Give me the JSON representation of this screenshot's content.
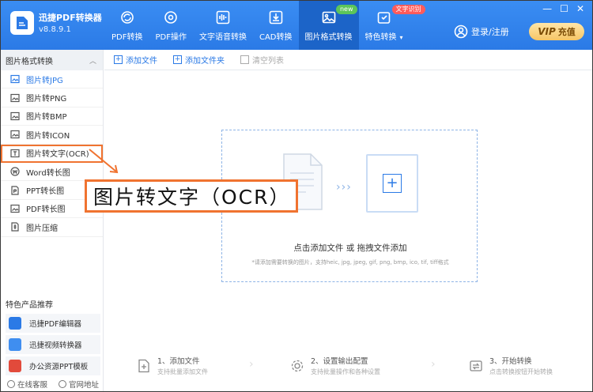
{
  "app": {
    "name": "迅捷PDF转换器",
    "version": "v8.8.9.1"
  },
  "nav": [
    {
      "label": "PDF转换",
      "icon": "refresh-icon"
    },
    {
      "label": "PDF操作",
      "icon": "compass-icon"
    },
    {
      "label": "文字语音转换",
      "icon": "audio-wave-icon"
    },
    {
      "label": "CAD转换",
      "icon": "download-box-icon"
    },
    {
      "label": "图片格式转换",
      "icon": "image-icon",
      "badge": "new",
      "active": true
    },
    {
      "label": "特色转换",
      "icon": "star-refresh-icon",
      "badge": "文字识别",
      "caret": "▾"
    }
  ],
  "header": {
    "login": "登录/注册",
    "vip_mark": "VIP",
    "vip_label": "充值",
    "win": {
      "min": "—",
      "max": "☐",
      "close": "✕"
    }
  },
  "sidebar": {
    "title": "图片格式转换",
    "collapse": "︿",
    "items": [
      {
        "label": "图片转JPG",
        "active": true
      },
      {
        "label": "图片转PNG"
      },
      {
        "label": "图片转BMP"
      },
      {
        "label": "图片转ICON"
      },
      {
        "label": "图片转文字(OCR)",
        "highlight": true
      },
      {
        "label": "Word转长图"
      },
      {
        "label": "PPT转长图"
      },
      {
        "label": "PDF转长图"
      },
      {
        "label": "图片压缩"
      }
    ],
    "featured_title": "特色产品推荐",
    "featured": [
      {
        "label": "迅捷PDF编辑器",
        "color": "#2b7ae6"
      },
      {
        "label": "迅捷视频转换器",
        "color": "#3f8ef0"
      },
      {
        "label": "办公资源PPT模板",
        "color": "#e24a3b"
      }
    ],
    "footer": {
      "service": "在线客服",
      "website": "官网地址"
    }
  },
  "toolbar": {
    "add_file": "添加文件",
    "add_folder": "添加文件夹",
    "clear_list": "清空列表"
  },
  "dropzone": {
    "arrows": "›››",
    "main_a": "点击添加文件",
    "or": "或",
    "main_b": "拖拽文件添加",
    "hint": "*请添加需要转换的图片，支持heic, jpg, jpeg, gif, png, bmp, ico, tif, tiff格式"
  },
  "steps": [
    {
      "title": "1、添加文件",
      "sub": "支持批量添加文件"
    },
    {
      "title": "2、设置输出配置",
      "sub": "支持批量操作和各种设置"
    },
    {
      "title": "3、开始转换",
      "sub": "点击转换按钮开始转换"
    }
  ],
  "annotation": {
    "text": "图片转文字（OCR）"
  },
  "colors": {
    "header": "#2b7ae6",
    "accent": "#2b7ae6",
    "annotation": "#f07330",
    "vip": "#f6c565"
  }
}
